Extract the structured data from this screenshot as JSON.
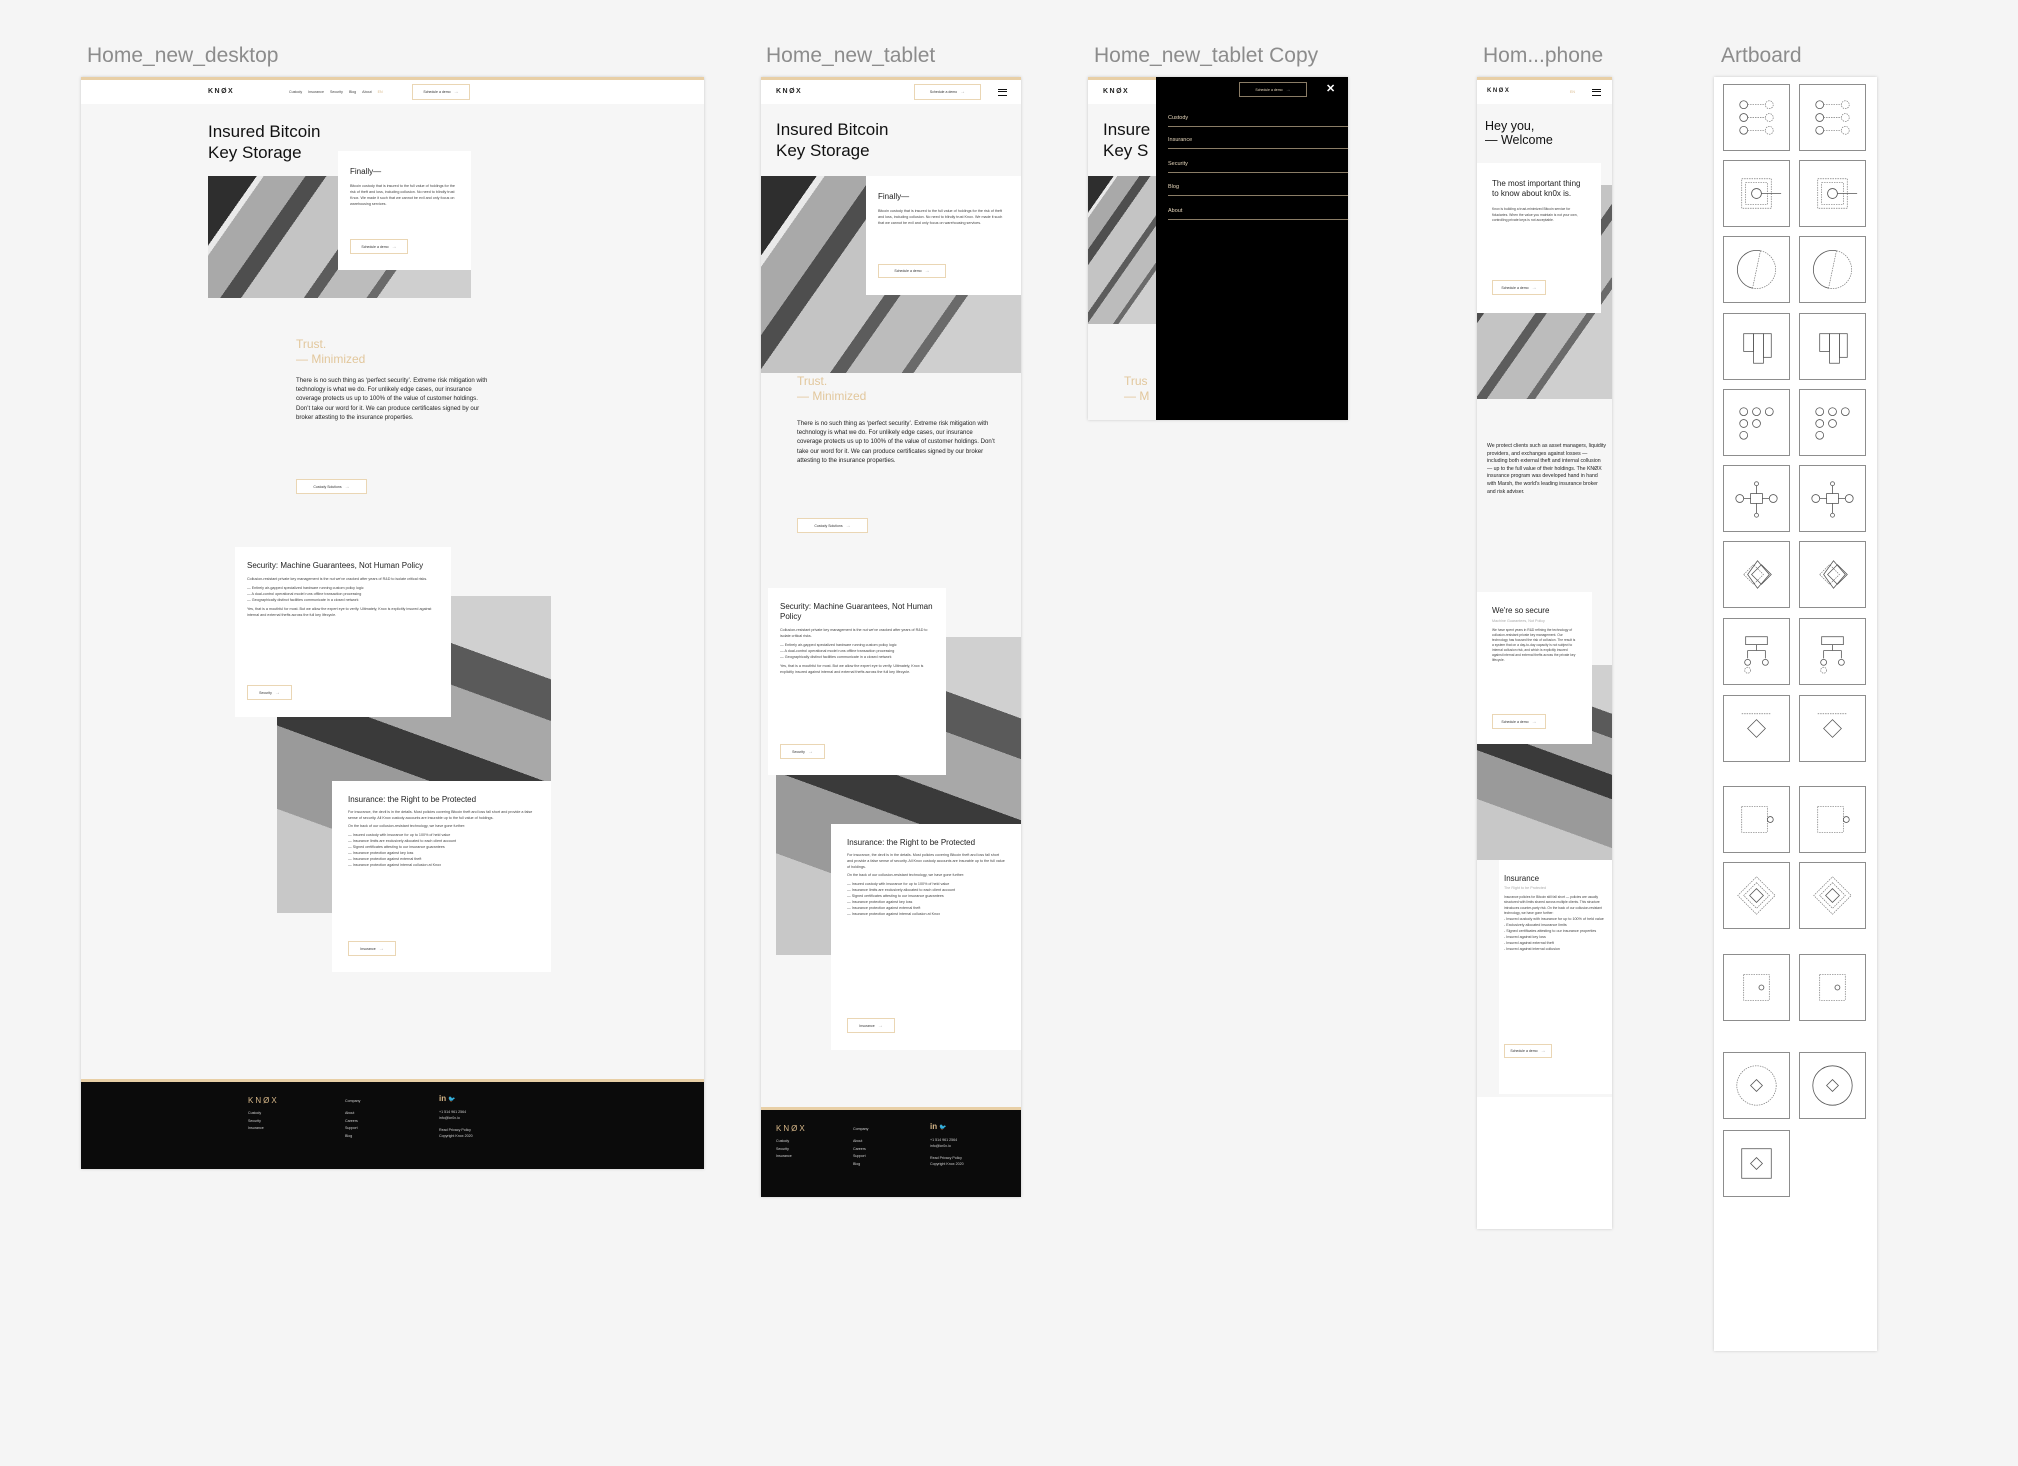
{
  "canvas": {
    "artboards": [
      "Home_new_desktop",
      "Home_new_tablet",
      "Home_new_tablet Copy",
      "Hom...phone",
      "Artboard"
    ]
  },
  "colors": {
    "accent": "#e8cfa6",
    "gold_text": "#d9b98a",
    "footer_bg": "#0b0b0b",
    "canvas_bg": "#f5f5f5"
  },
  "nav": {
    "logo": "KNØX",
    "links": [
      "Custody",
      "Insurance",
      "Security",
      "Blog",
      "About"
    ],
    "lang": "EN",
    "cta": "Schedule a demo",
    "menu_icon": "hamburger-icon",
    "close_icon": "close-icon"
  },
  "hero": {
    "title_line1": "Insured Bitcoin",
    "title_line2": "Key Storage",
    "card_title": "Finally—",
    "card_text": "Bitcoin custody that is insured to the full value of holdings for the risk of theft and loss, including collusion. No need to blindly trust Knox. We made it such that we cannot be evil and only focus on warehousing services.",
    "card_button": "Schedule a demo"
  },
  "trust": {
    "line1": "Trust.",
    "line2": "— Minimized",
    "body": "There is no such thing as ‘perfect security’. Extreme risk mitigation with technology is what we do. For unlikely edge cases, our insurance coverage protects us up to 100% of the value of customer holdings. Don’t take our word for it. We can produce certificates signed by our broker attesting to the insurance properties.",
    "button": "Custody Solutions"
  },
  "security": {
    "title": "Security: Machine Guarantees, Not Human Policy",
    "intro": "Collusion-resistant private key management is the nut we've cracked after years of R&D to isolate critical risks.",
    "items": [
      "— Entirely air-gapped specialized hardware running custom policy logic",
      "— A dual-control operational model runs offline transaction processing",
      "— Geographically distinct facilities communicate in a closed network"
    ],
    "outro": "Yes, that is a mouthful for most. But we allow the expert eye to verify. Ultimately, Knox is explicitly insured against internal and external thefts across the full key lifecycle.",
    "button": "Security"
  },
  "insurance": {
    "title": "Insurance: the Right to be Protected",
    "intro": "For insurance, the devil is in the details. Most policies covering Bitcoin theft and loss fall short and provide a false sense of security. All Knox custody accounts are insurable up to the full value of holdings.",
    "intro2": "On the back of our collusion-resistant technology, we have gone further:",
    "items": [
      "— Insured custody with insurance for up to 100% of held value",
      "— Insurance limits are exclusively allocated to each client account",
      "— Signed certificates attesting to our insurance guarantees",
      "— Insurance protection against key loss",
      "— Insurance protection against external theft",
      "— Insurance protection against internal collusion at Knox"
    ],
    "button": "Insurance"
  },
  "footer": {
    "logo": "KNØX",
    "col1": [
      "Custody",
      "Security",
      "Insurance"
    ],
    "col2_title": "Company",
    "col2": [
      "About",
      "Careers",
      "Support",
      "Blog"
    ],
    "social": [
      "linkedin-icon",
      "twitter-icon"
    ],
    "social_labels": [
      "in",
      "🐦"
    ],
    "phone": "+1 514 961 2564",
    "email": "info@kn0x.io",
    "privacy": "Read Privacy Policy",
    "copyright": "Copyright Knox 2020"
  },
  "tablet_copy": {
    "menu": [
      "Custody",
      "Insurance",
      "Security",
      "Blog",
      "About"
    ],
    "bg_title_line1": "Insure",
    "bg_title_line2": "Key S",
    "bg_trust": "Trus",
    "bg_trust2": "— M"
  },
  "phone": {
    "title_line1": "Hey you,",
    "title_line2": "— Welcome",
    "card_title": "The most important thing to know about kn0x is.",
    "card_text": "Knox is building a trust-minimized Bitcoin service for fiduciaries. When the value you maintain is not your own, controlling private keys is not acceptable.",
    "button": "Schedule a demo",
    "body": "We protect clients such as asset managers, liquidity providers, and exchanges against losses — including both external theft and internal collusion — up to the full value of their holdings. The KNØX insurance program was developed hand in hand with Marsh, the world's leading insurance broker and risk adviser.",
    "secure_title": "We're so secure",
    "secure_sub": "Machine Guarantees, Not Policy",
    "secure_text": "We have spent years in R&D refining the technology of collusion-resistant private key management. Our technology has focused the risk of collusion. The result is a system that on a day-to-day capacity is not subject to internal collusion risk, and which is explicitly insured against internal and external thefts across the private key lifecycle.",
    "ins_title": "Insurance",
    "ins_sub": "The Right to be Protected",
    "ins_text": "Insurance policies for Bitcoin still fall short — policies are usually structured with limits shared across multiple clients. This structure introduces counter-party risk. On the back of our collusion-resistant technology, we have gone further:",
    "ins_items": [
      "- Insured custody with insurance for up to 100% of held value",
      "- Exclusively allocated insurance limits",
      "- Signed certificates attesting to our insurance properties",
      "- Insured against key loss",
      "- Insured against external theft",
      "- Insured against internal collusion"
    ]
  },
  "artboard_icons": [
    "dots-link",
    "dots-link",
    "square-circle",
    "square-circle",
    "circle-split",
    "circle-split",
    "bars",
    "bars",
    "circles-grid",
    "circles-grid",
    "node-chain",
    "node-chain",
    "diamond-stack",
    "diamond-stack",
    "tree",
    "tree",
    "diamond-line",
    "diamond-line",
    "square-dot",
    "square-dot",
    "diamond-nested",
    "diamond-nested",
    "square-dashed-dot",
    "square-dashed-dot",
    "circle-diamond-dashed",
    "circle-diamond",
    "square-diamond"
  ]
}
